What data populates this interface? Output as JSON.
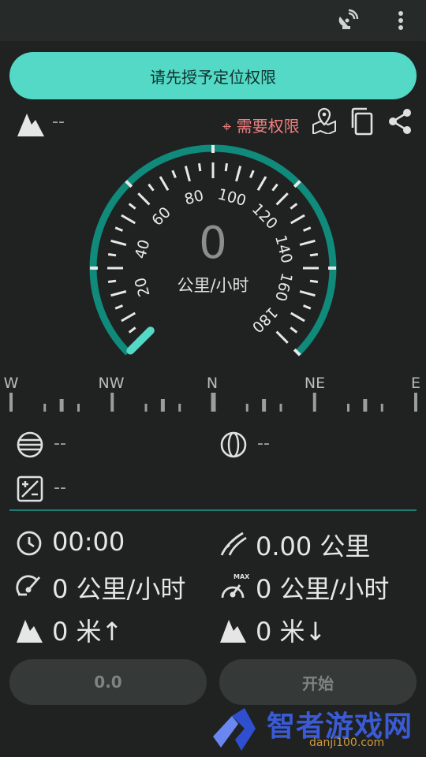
{
  "toolbar": {
    "icons": [
      "satellite-dish-icon",
      "more-vert-icon"
    ]
  },
  "permission_button": {
    "label": "请先授予定位权限"
  },
  "header_row": {
    "altitude_value": "--",
    "permission_warning": "⌖ 需要权限",
    "icons": [
      "mountain-icon",
      "map-pin-icon",
      "copy-icon",
      "share-icon"
    ]
  },
  "speedometer": {
    "value": "0",
    "unit": "公里/小时",
    "tick_labels": [
      "20",
      "40",
      "60",
      "80",
      "100",
      "120",
      "140",
      "160",
      "180"
    ],
    "min": 0,
    "max": 180,
    "current": 0,
    "accent": "#0f8a7b",
    "needle_color": "#53d9c6"
  },
  "compass": {
    "labels": [
      "W",
      "NW",
      "N",
      "NE",
      "E"
    ]
  },
  "coords": {
    "latitude": "--",
    "longitude": "--",
    "accuracy": "--"
  },
  "stats": {
    "duration": "00:00",
    "distance": "0.00 公里",
    "avg_speed": "0 公里/小时",
    "max_speed": "0 公里/小时",
    "ascent": "0 米↑",
    "descent": "0 米↓"
  },
  "buttons": {
    "left": "0.0",
    "right": "开始"
  },
  "watermark": {
    "title": "智者游戏网",
    "sub": "danji100.com"
  }
}
